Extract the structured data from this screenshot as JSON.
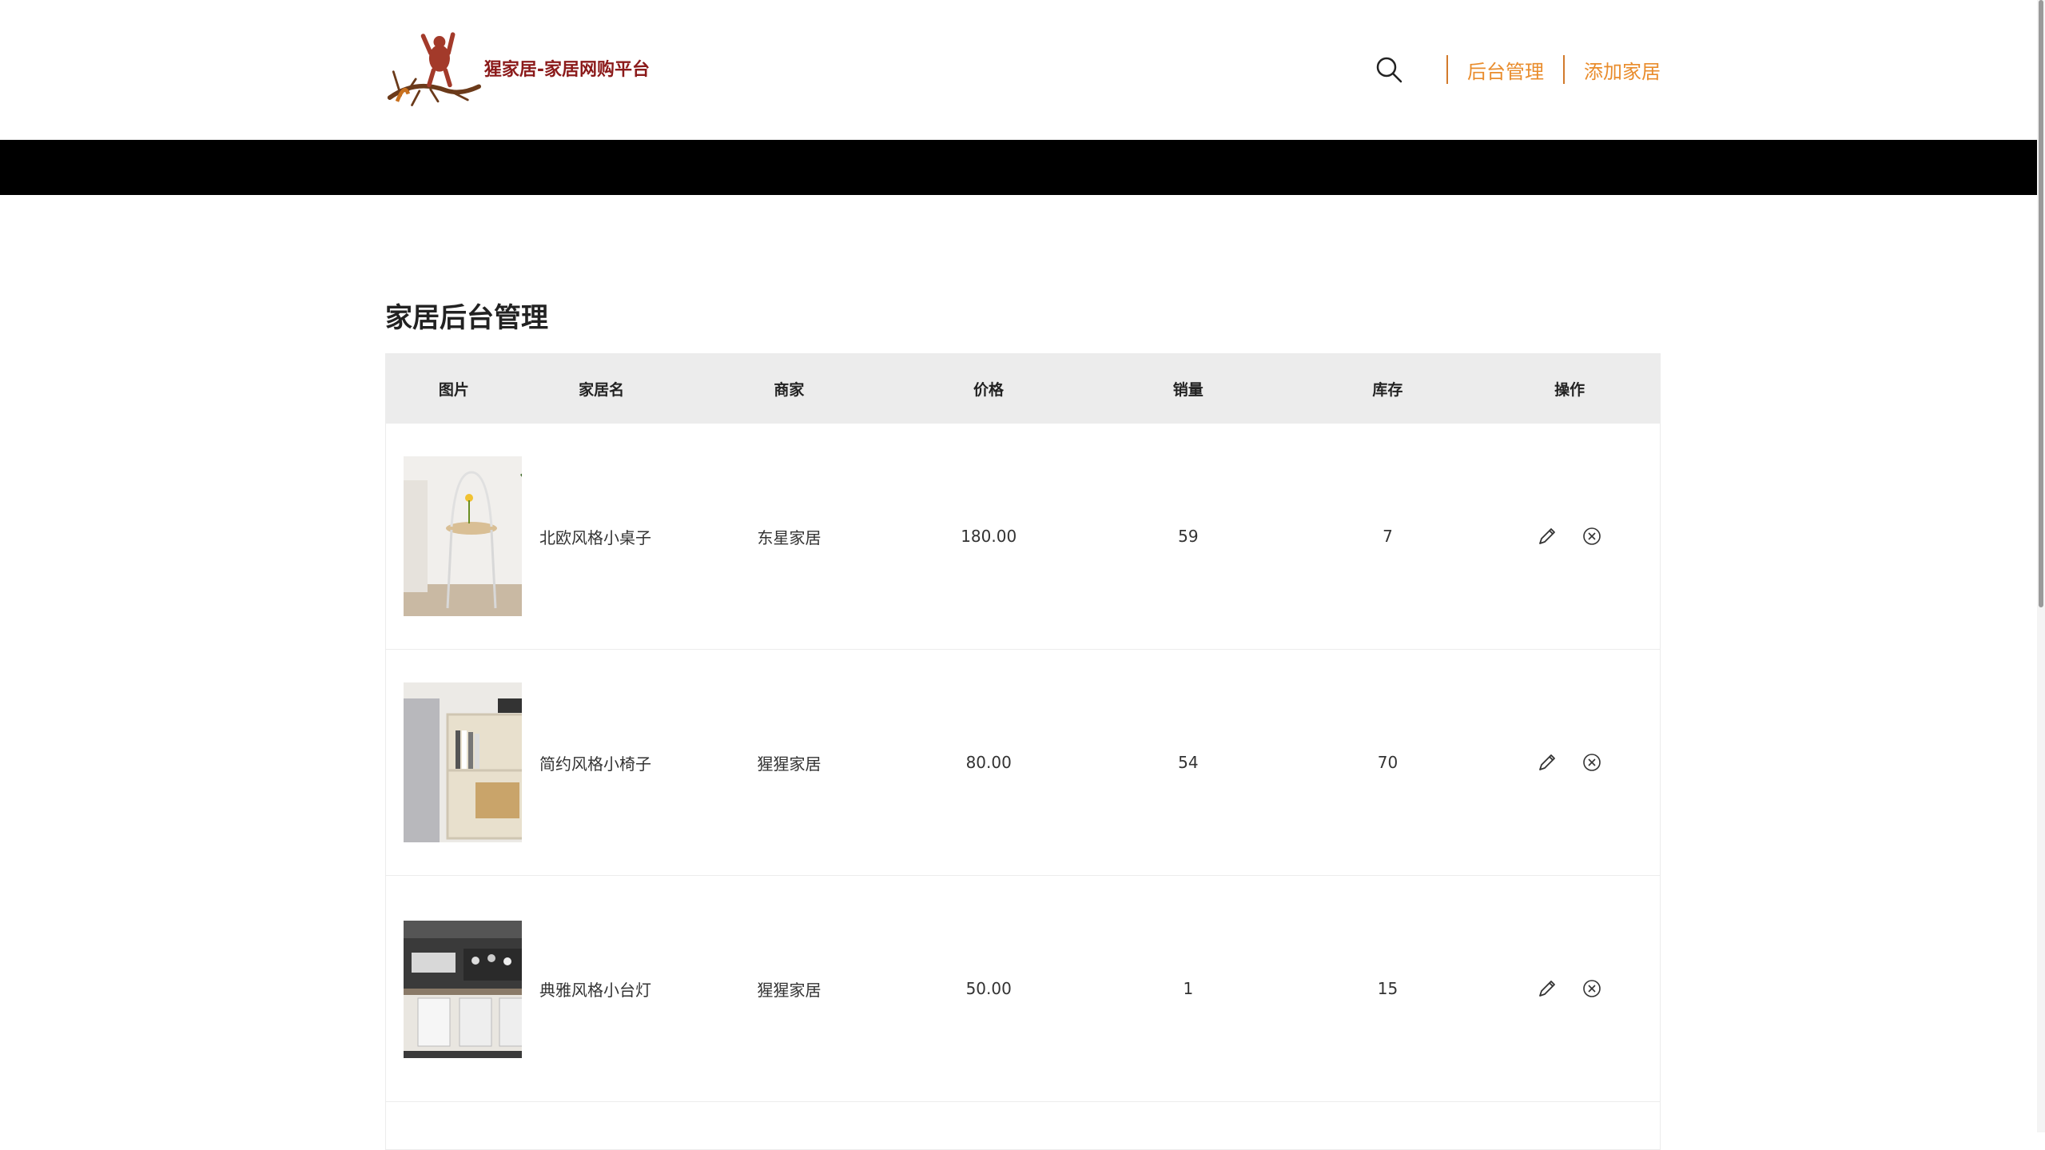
{
  "header": {
    "logo_text": "猩家居-家居网购平台",
    "nav": {
      "search_icon": "search-icon",
      "admin_label": "后台管理",
      "add_label": "添加家居"
    }
  },
  "page": {
    "title": "家居后台管理"
  },
  "table": {
    "columns": [
      "图片",
      "家居名",
      "商家",
      "价格",
      "销量",
      "库存",
      "操作"
    ],
    "rows": [
      {
        "name": "北欧风格小桌子",
        "shop": "东星家居",
        "price": "180.00",
        "sales": "59",
        "stock": "7"
      },
      {
        "name": "简约风格小椅子",
        "shop": "猩猩家居",
        "price": "80.00",
        "sales": "54",
        "stock": "70"
      },
      {
        "name": "典雅风格小台灯",
        "shop": "猩猩家居",
        "price": "50.00",
        "sales": "1",
        "stock": "15"
      }
    ],
    "op_icons": [
      "pencil-icon",
      "close-circle-icon"
    ]
  },
  "colors": {
    "accent": "#e98c2c",
    "header_bar": "#000000",
    "table_header_bg": "#ececec",
    "logo_text": "#8b1a1a"
  }
}
